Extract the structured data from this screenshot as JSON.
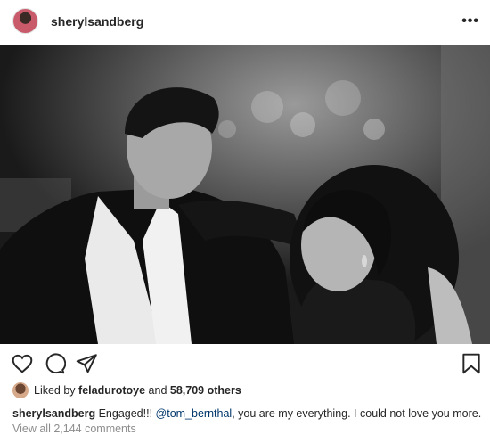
{
  "post": {
    "username": "sherylsandberg",
    "more_icon": "more-horizontal-icon"
  },
  "actions": {
    "like_icon": "heart-icon",
    "comment_icon": "comment-icon",
    "share_icon": "send-icon",
    "save_icon": "bookmark-icon"
  },
  "likes": {
    "prefix": "Liked by",
    "user": "feladurotoye",
    "connector": "and",
    "others": "58,709 others"
  },
  "caption": {
    "username": "sherylsandberg",
    "text_before": "Engaged!!!",
    "mention": "@tom_bernthal",
    "text_after": ", you are my everything. I could not love you more."
  },
  "comments": {
    "view_all": "View all 2,144 comments"
  }
}
